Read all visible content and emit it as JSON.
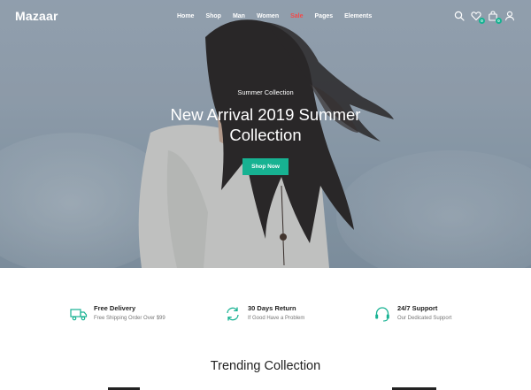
{
  "brand": {
    "logo": "Mazaar",
    "accent": "#17b292",
    "sale_color": "#f24a4a"
  },
  "nav": {
    "items": [
      {
        "label": "Home"
      },
      {
        "label": "Shop"
      },
      {
        "label": "Man"
      },
      {
        "label": "Women"
      },
      {
        "label": "Sale"
      },
      {
        "label": "Pages"
      },
      {
        "label": "Elements"
      }
    ]
  },
  "header_icons": {
    "search": "search-icon",
    "wishlist": {
      "icon": "heart-icon",
      "count": "0"
    },
    "cart": {
      "icon": "bag-icon",
      "count": "0"
    },
    "account": "user-icon"
  },
  "hero": {
    "subtitle": "Summer Collection",
    "headline": "New Arrival 2019 Summer Collection",
    "cta_label": "Shop Now"
  },
  "features": [
    {
      "icon": "truck-icon",
      "title": "Free Delivery",
      "desc": "Free Shipping Order Over $99"
    },
    {
      "icon": "refresh-icon",
      "title": "30 Days Return",
      "desc": "If Good Have a Problem"
    },
    {
      "icon": "headset-icon",
      "title": "24/7 Support",
      "desc": "Our Dedicated Support"
    }
  ],
  "trending": {
    "title": "Trending Collection"
  }
}
